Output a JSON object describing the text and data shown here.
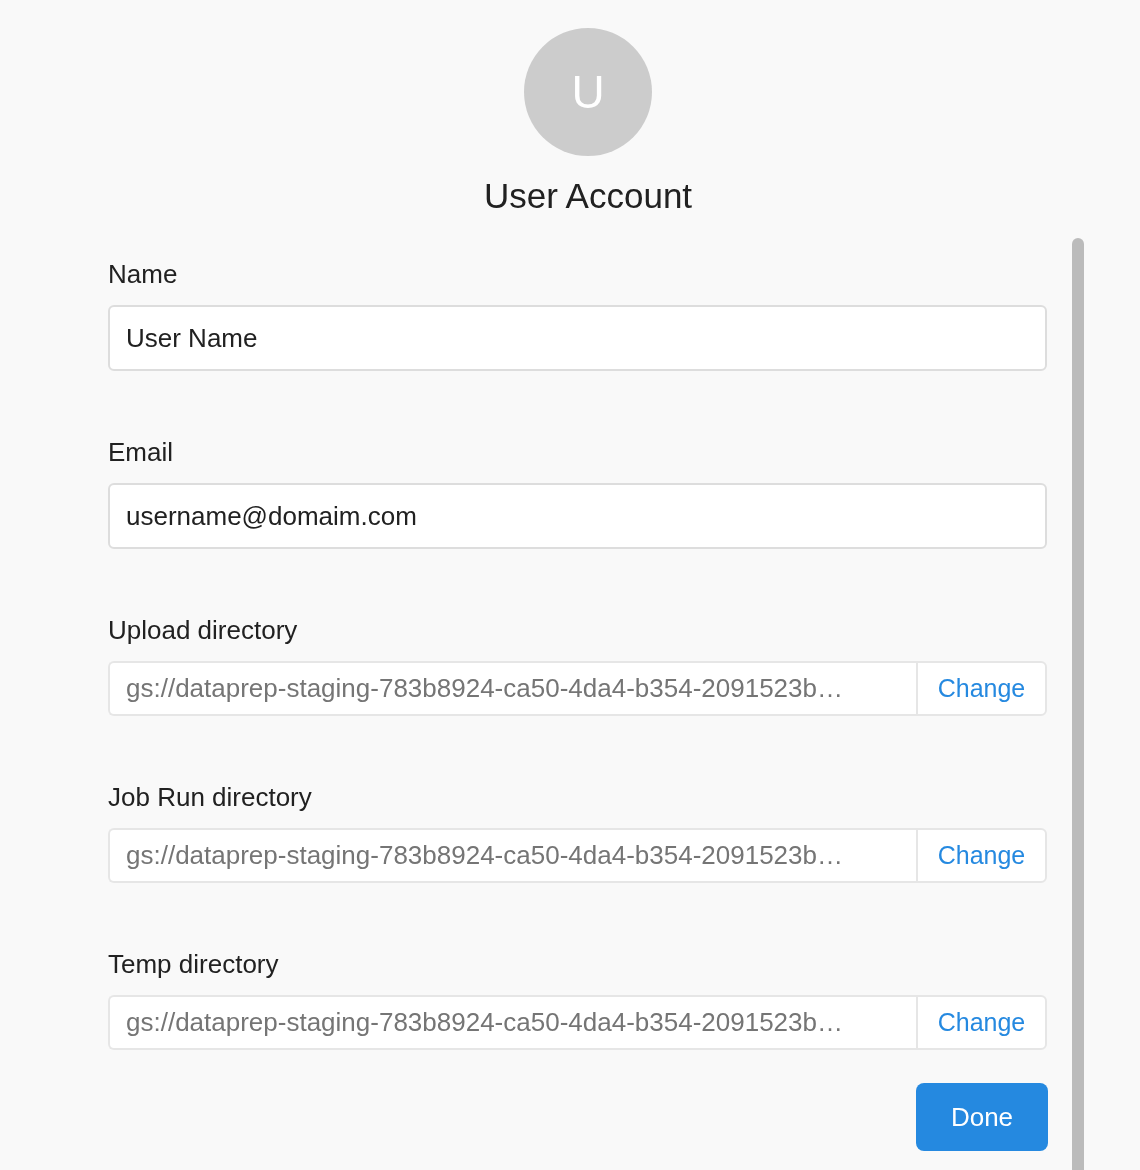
{
  "avatar": {
    "initial": "U"
  },
  "title": "User Account",
  "fields": [
    {
      "kind": "text",
      "label": "Name",
      "value": "User Name"
    },
    {
      "kind": "text",
      "label": "Email",
      "value": "username@domaim.com"
    },
    {
      "kind": "directory",
      "label": "Upload directory",
      "value": "gs://dataprep-staging-783b8924-ca50-4da4-b354-2091523b…",
      "button": "Change"
    },
    {
      "kind": "directory",
      "label": "Job Run directory",
      "value": "gs://dataprep-staging-783b8924-ca50-4da4-b354-2091523b…",
      "button": "Change"
    },
    {
      "kind": "directory",
      "label": "Temp directory",
      "value": "gs://dataprep-staging-783b8924-ca50-4da4-b354-2091523b…",
      "button": "Change"
    }
  ],
  "done_button": "Done"
}
